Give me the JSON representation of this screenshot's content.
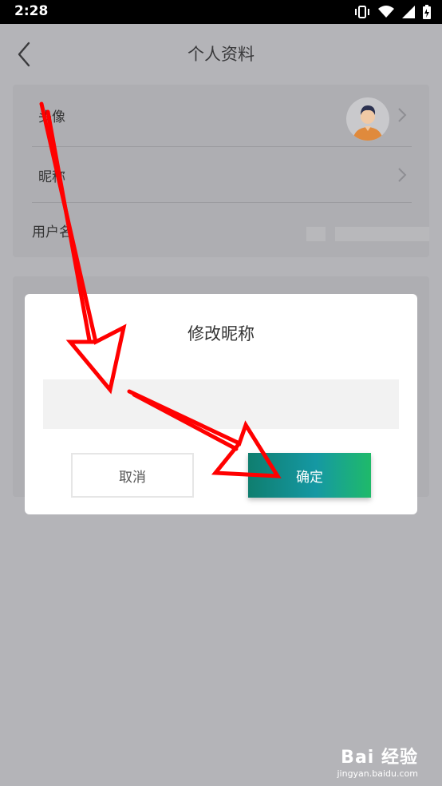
{
  "status_bar": {
    "time": "2:28"
  },
  "header": {
    "title": "个人资料"
  },
  "profile_rows": [
    {
      "label": "头像"
    },
    {
      "label": "昵称"
    },
    {
      "label": "用户名"
    }
  ],
  "dialog": {
    "title": "修改昵称",
    "input_value": "",
    "cancel_label": "取消",
    "confirm_label": "确定"
  },
  "watermark": {
    "logo": "Bai 经验",
    "url": "jingyan.baidu.com"
  },
  "colors": {
    "annotation_arrow": "#ff0000",
    "confirm_gradient_start": "#0f7e6f",
    "confirm_gradient_end": "#1fba6a"
  }
}
